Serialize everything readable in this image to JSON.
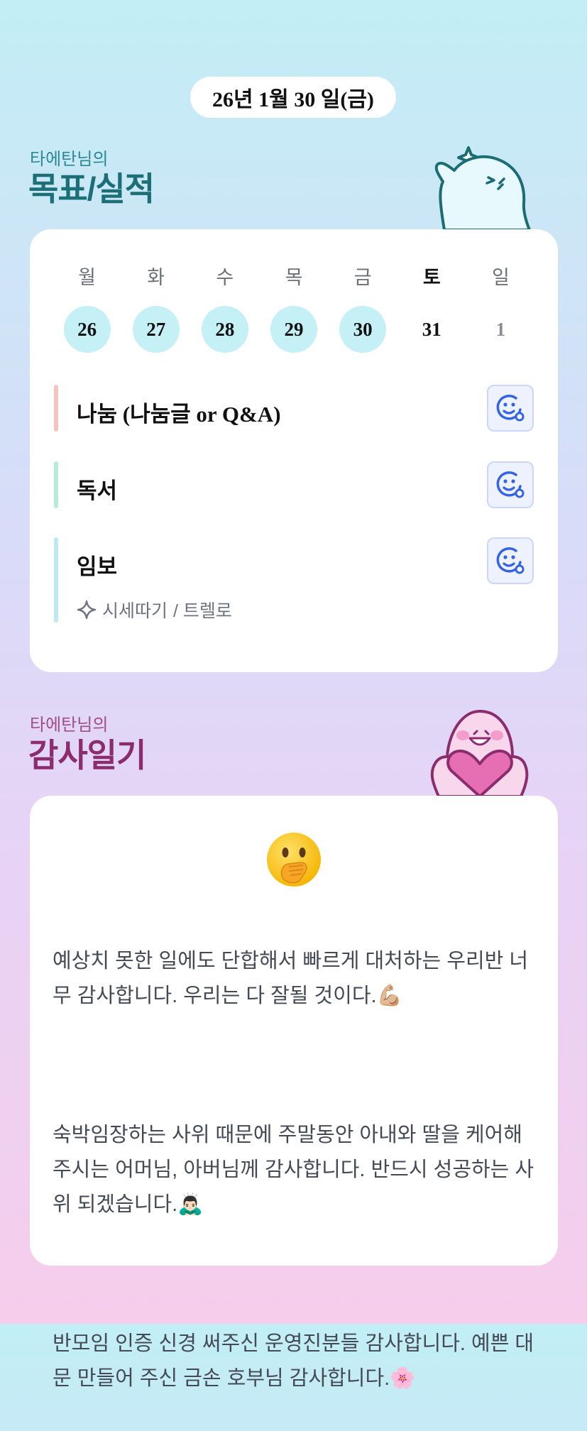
{
  "date_label": "26년 1월 30 일(금)",
  "goals_section": {
    "subtitle": "타에탄님의",
    "title": "목표/실적"
  },
  "week": {
    "weekdays": [
      "월",
      "화",
      "수",
      "목",
      "금",
      "토",
      "일"
    ],
    "dates": [
      "26",
      "27",
      "28",
      "29",
      "30",
      "31",
      "1"
    ],
    "completed": [
      true,
      true,
      true,
      true,
      true,
      false,
      false
    ]
  },
  "goals": [
    {
      "label": "나눔 (나눔글 or Q&A)",
      "bar_color": "#f5c5bd"
    },
    {
      "label": "독서",
      "bar_color": "#b4ecd8"
    },
    {
      "label": "임보",
      "bar_color": "#bdeaf1",
      "sub": "시세따기",
      "sub_extra": "/ 트렐로"
    }
  ],
  "thanks_section": {
    "subtitle": "타에탄님의",
    "title": "감사일기",
    "emoji": "🫢",
    "entries": [
      "예상치 못한 일에도 단합해서 빠르게 대처하는 우리반 너무 감사합니다. 우리는 다 잘될 것이다.💪🏼",
      "숙박임장하는 사위 때문에 주말동안 아내와 딸을 케어해주시는 어머님, 아버님께 감사합니다. 반드시 성공하는 사위 되겠습니다.🙇🏻‍♂️",
      "반모임 인증 신경 써주신 운영진분들 감사합니다. 예쁜 대문 만들어 주신 금손 호부님 감사합니다.🌸"
    ]
  }
}
